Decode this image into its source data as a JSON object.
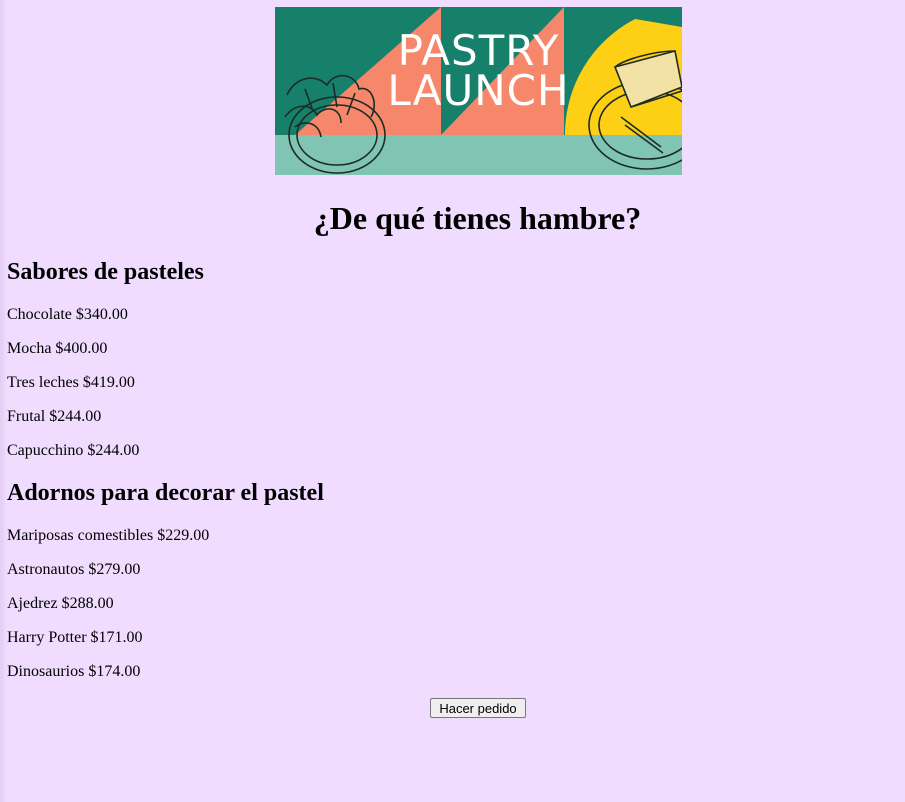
{
  "banner": {
    "line1": "PASTRY",
    "line2": "LAUNCH"
  },
  "page": {
    "title": "¿De qué tienes hambre?"
  },
  "sections": [
    {
      "title": "Sabores de pasteles",
      "items": [
        "Chocolate $340.00",
        "Mocha $400.00",
        "Tres leches $419.00",
        "Frutal $244.00",
        "Capucchino $244.00"
      ]
    },
    {
      "title": "Adornos para decorar el pastel",
      "items": [
        "Mariposas comestibles $229.00",
        "Astronautos $279.00",
        "Ajedrez $288.00",
        "Harry Potter $171.00",
        "Dinosaurios $174.00"
      ]
    }
  ],
  "order_button": {
    "label": "Hacer pedido"
  },
  "colors": {
    "background": "#efdcfe",
    "banner_green": "#16806a",
    "banner_salmon": "#f7876b",
    "banner_teal": "#80c4b3",
    "banner_yellow": "#fdd016"
  }
}
